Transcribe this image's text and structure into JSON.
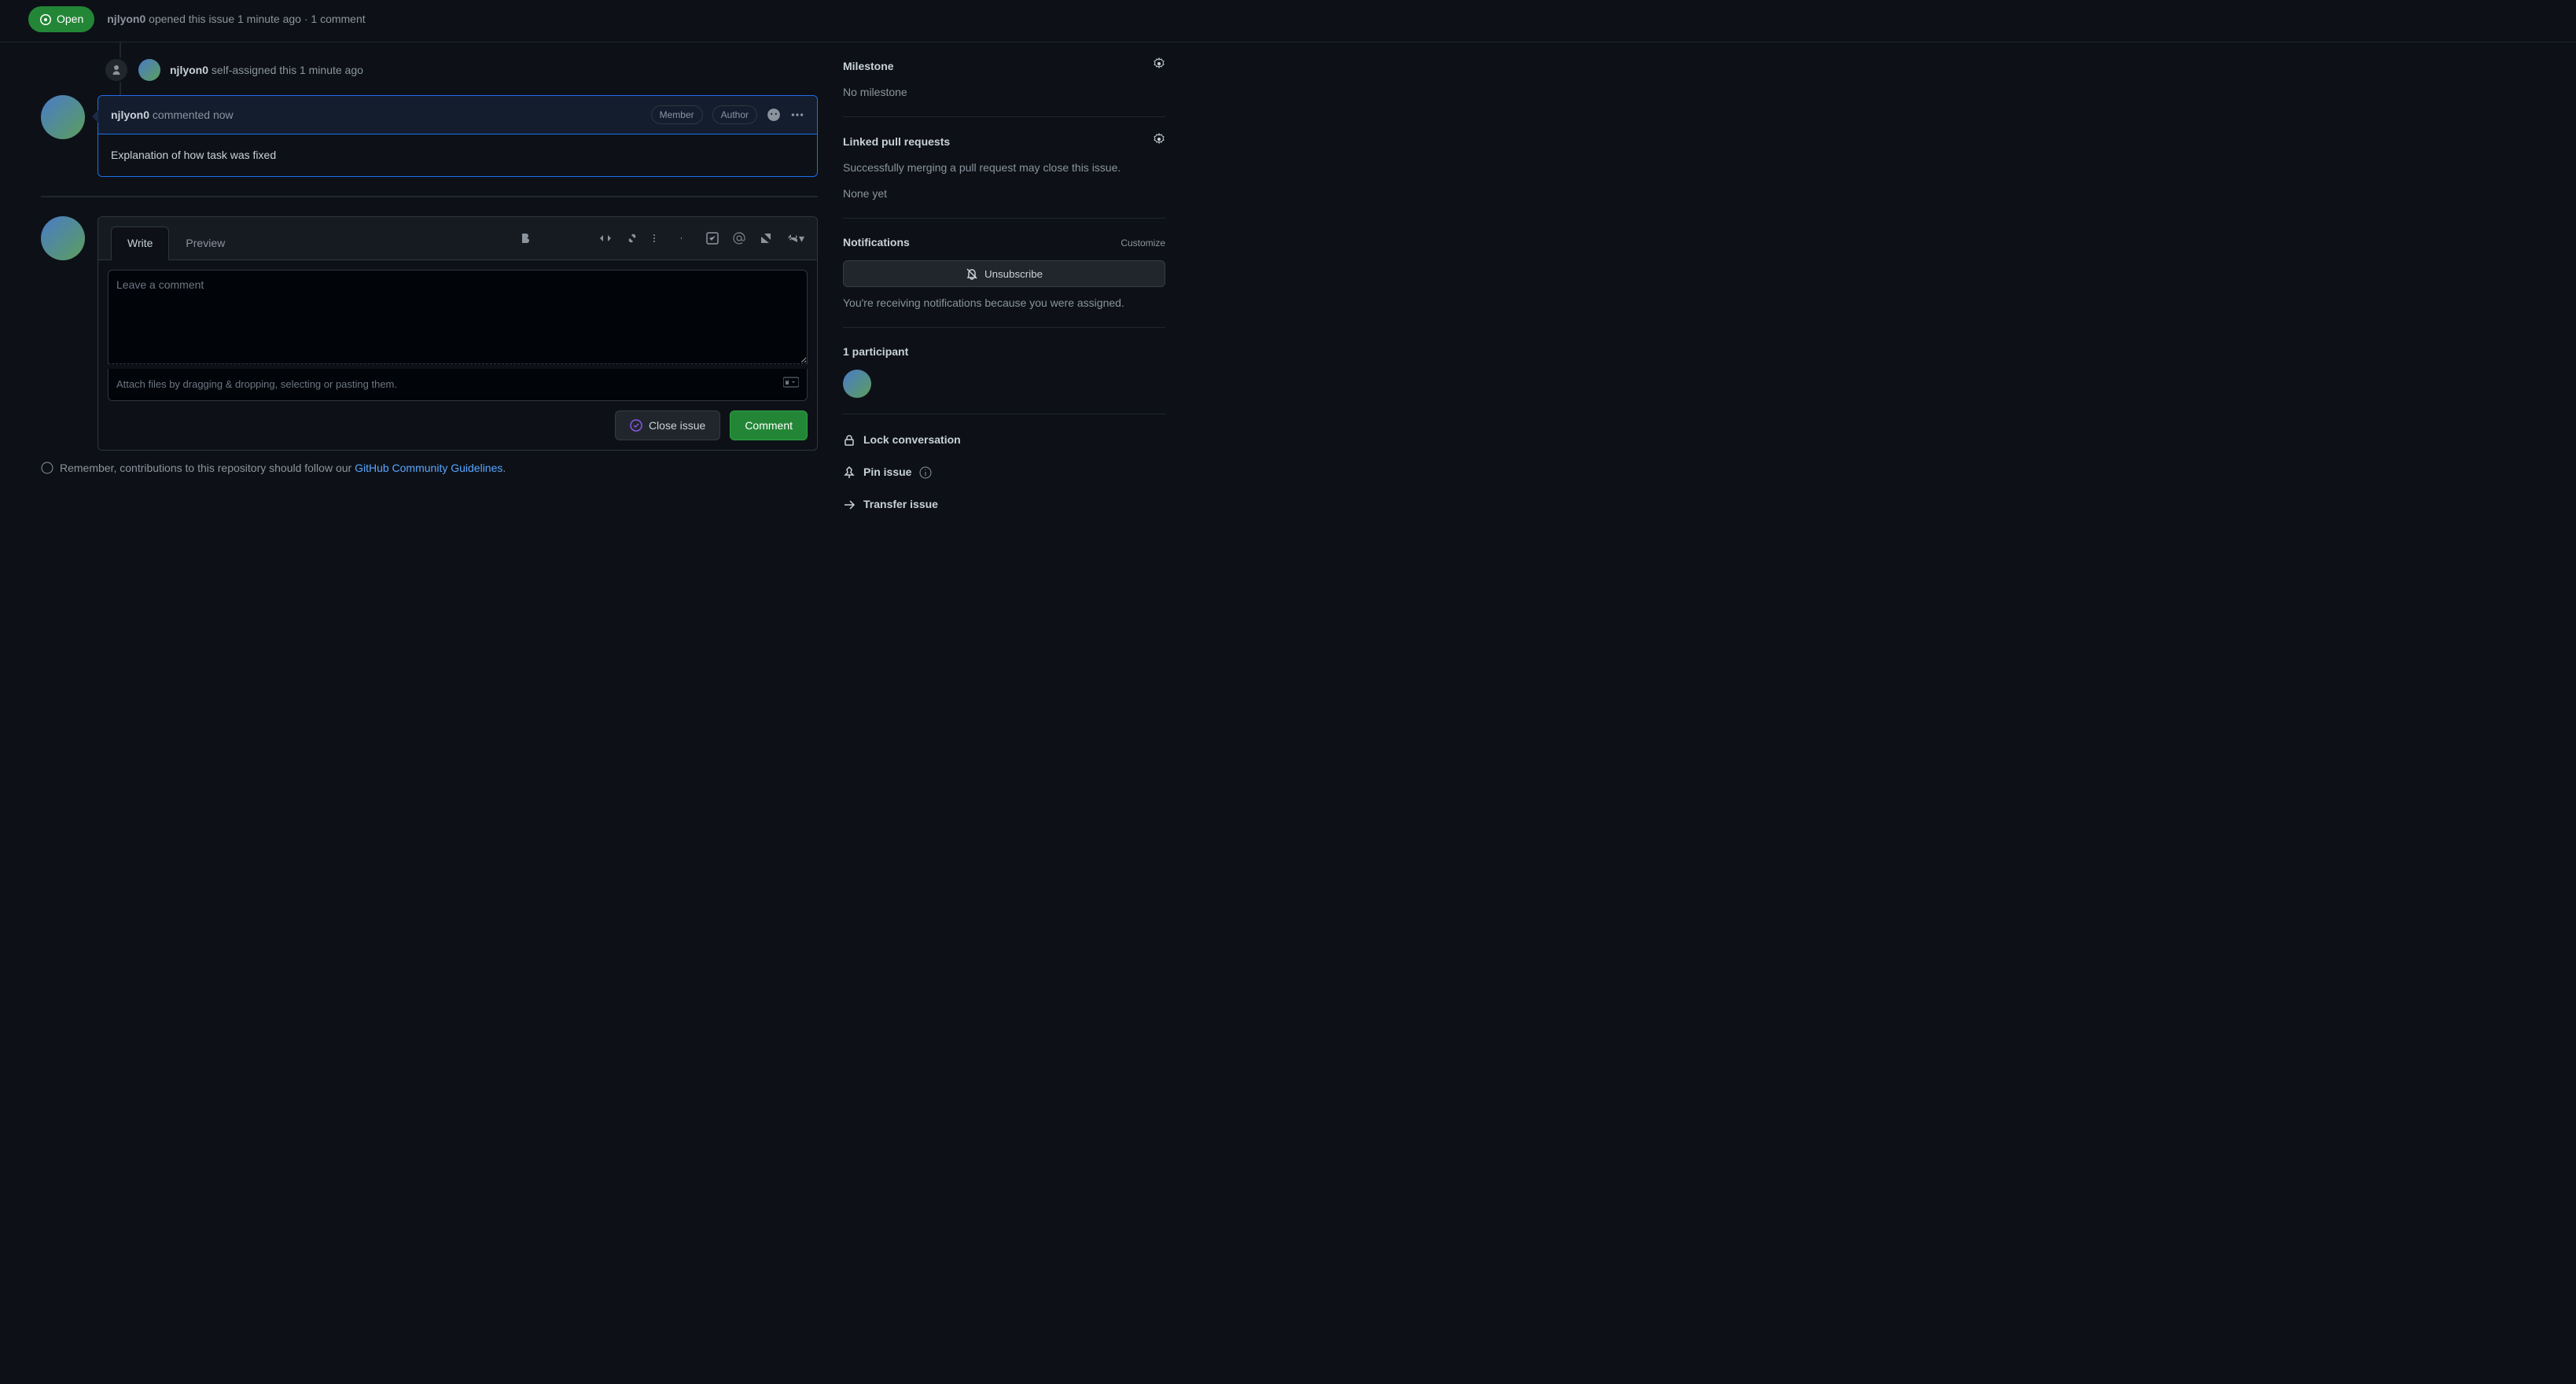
{
  "header": {
    "status": "Open",
    "author": "njlyon0",
    "opened_text": "opened this issue 1 minute ago · 1 comment"
  },
  "timeline": {
    "self_assign": {
      "author": "njlyon0",
      "text": "self-assigned this 1 minute ago"
    }
  },
  "comment": {
    "author": "njlyon0",
    "verb": "commented",
    "time": "now",
    "badges": {
      "member": "Member",
      "author": "Author"
    },
    "body": "Explanation of how task was fixed"
  },
  "editor": {
    "tabs": {
      "write": "Write",
      "preview": "Preview"
    },
    "placeholder": "Leave a comment",
    "attach_hint": "Attach files by dragging & dropping, selecting or pasting them.",
    "close_btn": "Close issue",
    "comment_btn": "Comment"
  },
  "guidelines": {
    "prefix": "Remember, contributions to this repository should follow our ",
    "link": "GitHub Community Guidelines",
    "suffix": "."
  },
  "sidebar": {
    "milestone": {
      "title": "Milestone",
      "value": "No milestone"
    },
    "linked_pr": {
      "title": "Linked pull requests",
      "description": "Successfully merging a pull request may close this issue.",
      "value": "None yet"
    },
    "notifications": {
      "title": "Notifications",
      "customize": "Customize",
      "unsubscribe": "Unsubscribe",
      "reason": "You're receiving notifications because you were assigned."
    },
    "participants": {
      "title": "1 participant"
    },
    "actions": {
      "lock": "Lock conversation",
      "pin": "Pin issue",
      "transfer": "Transfer issue"
    }
  }
}
